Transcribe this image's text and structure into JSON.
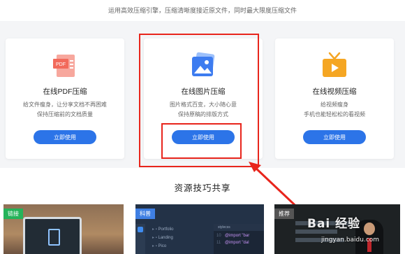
{
  "tagline": "运用高效压缩引擎，压缩清晰度接近原文件，同时最大限度压缩文件",
  "cards": [
    {
      "icon": "pdf-icon",
      "icon_label": "PDF",
      "title": "在线PDF压缩",
      "desc1": "给文件瘦身，让分享文档不再困难",
      "desc2": "保持压缩前的文档质量",
      "button": "立即使用",
      "accent": "#f26a5b"
    },
    {
      "icon": "image-icon",
      "title": "在线图片压缩",
      "desc1": "图片格式百变，大小随心意",
      "desc2": "保持原稿的排版方式",
      "button": "立即使用",
      "accent": "#3d7cf0"
    },
    {
      "icon": "tv-icon",
      "title": "在线视频压缩",
      "desc1": "给视频瘦身",
      "desc2": "手机也能轻松松的看视频",
      "button": "立即使用",
      "accent": "#f5a623"
    }
  ],
  "section_title": "资源技巧共享",
  "thumbs": [
    {
      "tag": "链接"
    },
    {
      "tag": "科普",
      "tree": [
        "Portfolio",
        "Landing",
        "Pico"
      ],
      "tab": "stylecss",
      "code": [
        "@import \"bar",
        "@import \"dal"
      ]
    },
    {
      "tag": "推荐"
    }
  ],
  "watermark": "Bai 经验",
  "watermark_url": "jingyan.baidu.com",
  "colors": {
    "button": "#2c74e8",
    "highlight": "#e8251c",
    "band": "#f4f5f7"
  }
}
